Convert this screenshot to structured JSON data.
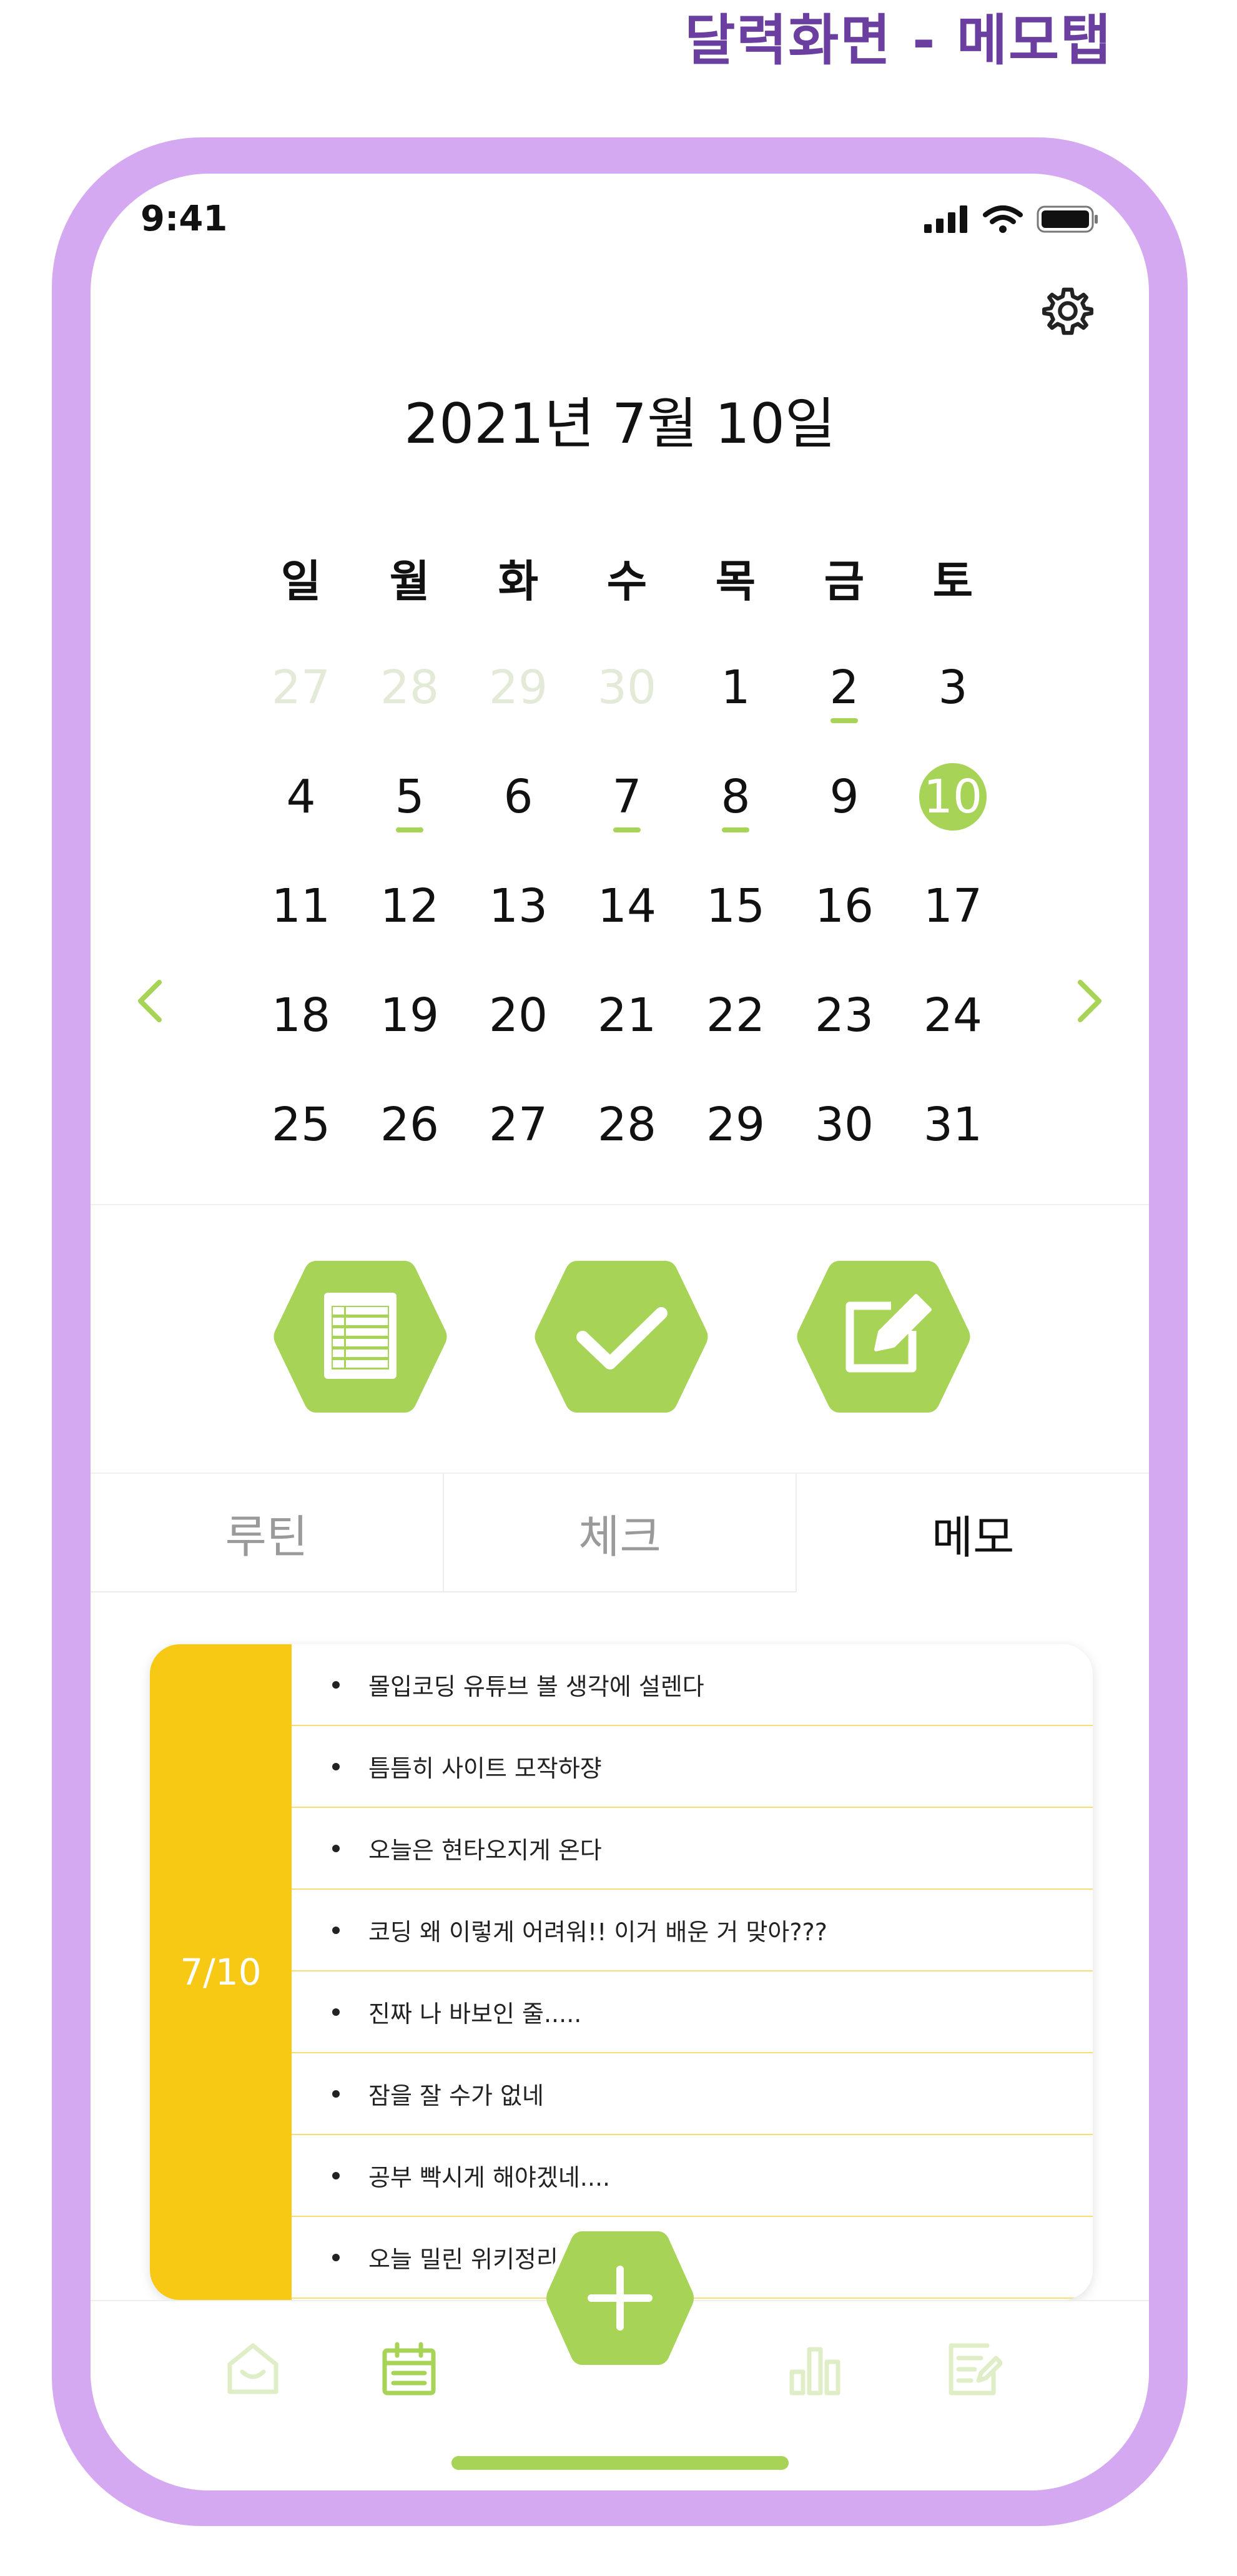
{
  "page_title": "달력화면 - 메모탭",
  "status_bar": {
    "time": "9:41"
  },
  "calendar": {
    "title": "2021년 7월 10일",
    "weekdays": [
      "일",
      "월",
      "화",
      "수",
      "목",
      "금",
      "토"
    ],
    "weeks": [
      [
        "27",
        "28",
        "29",
        "30",
        "1",
        "2",
        "3"
      ],
      [
        "4",
        "5",
        "6",
        "7",
        "8",
        "9",
        "10"
      ],
      [
        "11",
        "12",
        "13",
        "14",
        "15",
        "16",
        "17"
      ],
      [
        "18",
        "19",
        "20",
        "21",
        "22",
        "23",
        "24"
      ],
      [
        "25",
        "26",
        "27",
        "28",
        "29",
        "30",
        "31"
      ]
    ],
    "muted_days": [
      "27",
      "28",
      "29",
      "30"
    ],
    "marked_days": [
      "2",
      "5",
      "7",
      "8"
    ],
    "selected_day": "10"
  },
  "action_buttons": [
    {
      "icon": "table-icon"
    },
    {
      "icon": "check-icon"
    },
    {
      "icon": "edit-icon"
    }
  ],
  "tabs": [
    {
      "label": "루틴"
    },
    {
      "label": "체크"
    },
    {
      "label": "메모"
    }
  ],
  "active_tab": "메모",
  "memo": {
    "date": "7/10",
    "items": [
      "몰입코딩 유튜브 볼 생각에 설렌다",
      "틈틈히 사이트 모작하쟝",
      "오늘은 현타오지게 온다",
      "코딩 왜 이렇게 어려워!! 이거 배운 거 맞아???",
      "진짜 나 바보인 줄.....",
      "잠을 잘 수가 없네",
      "공부 빡시게 해야겠네....",
      "오늘 밀린 위키정리 블"
    ]
  },
  "bottom_nav": [
    "home-icon",
    "calendar-icon",
    "add-icon",
    "stats-icon",
    "memo-icon"
  ],
  "colors": {
    "accent_green": "#a7d357",
    "memo_yellow": "#f7c914",
    "frame_purple": "#d5a9f2",
    "title_purple": "#6b3fa0"
  }
}
